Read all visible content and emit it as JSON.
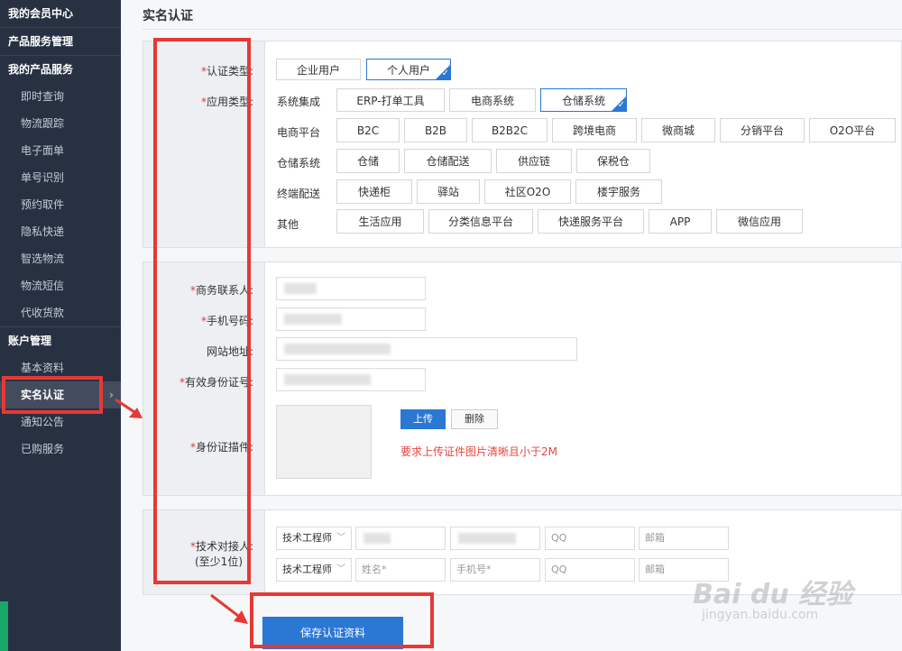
{
  "sidebar": {
    "head1": "我的会员中心",
    "head2": "产品服务管理",
    "head3": "我的产品服务",
    "services": [
      "即时查询",
      "物流跟踪",
      "电子面单",
      "单号识别",
      "预约取件",
      "隐私快递",
      "智选物流",
      "物流短信",
      "代收货款"
    ],
    "head4": "账户管理",
    "account": [
      "基本资料",
      "实名认证",
      "通知公告",
      "已购服务"
    ],
    "active_arrow": "›"
  },
  "page": {
    "title": "实名认证"
  },
  "auth": {
    "type_label": "认证类型",
    "app_label": "应用类型",
    "required_mark": "*",
    "colon": ":",
    "type_options": [
      "企业用户",
      "个人用户"
    ],
    "tick": "✓",
    "categories": [
      {
        "name": "系统集成",
        "options": [
          "ERP-打单工具",
          "电商系统",
          "仓储系统"
        ]
      },
      {
        "name": "电商平台",
        "options": [
          "B2C",
          "B2B",
          "B2B2C",
          "跨境电商",
          "微商城",
          "分销平台",
          "O2O平台"
        ]
      },
      {
        "name": "仓储系统",
        "options": [
          "仓储",
          "仓储配送",
          "供应链",
          "保税仓"
        ]
      },
      {
        "name": "终端配送",
        "options": [
          "快递柜",
          "驿站",
          "社区O2O",
          "楼宇服务"
        ]
      },
      {
        "name": "其他",
        "options": [
          "生活应用",
          "分类信息平台",
          "快递服务平台",
          "APP",
          "微信应用"
        ]
      }
    ]
  },
  "contact": {
    "biz_contact_label": "商务联系人",
    "phone_label": "手机号码",
    "website_label": "网站地址",
    "id_label": "有效身份证号",
    "id_scan_label": "身份证描件",
    "upload_label": "上传",
    "delete_label": "删除",
    "upload_hint": "要求上传证件图片清晰且小于2M"
  },
  "tech": {
    "label_line1": "技术对接人",
    "label_line2": "(至少1位)",
    "rows": [
      {
        "role": "技术工程师",
        "name": "",
        "phone": "",
        "qq": "QQ",
        "email": "邮箱"
      },
      {
        "role": "技术工程师",
        "name": "姓名*",
        "phone": "手机号*",
        "qq": "QQ",
        "email": "邮箱"
      }
    ],
    "chevron": "﹀"
  },
  "save_label": "保存认证资料",
  "watermark": {
    "line1": "Bai du 经验",
    "line2": "jingyan.baidu.com"
  },
  "colors": {
    "accent": "#2b77d4",
    "annotation": "#e53935",
    "required": "#e0393e",
    "sidebar_bg": "#283142"
  }
}
